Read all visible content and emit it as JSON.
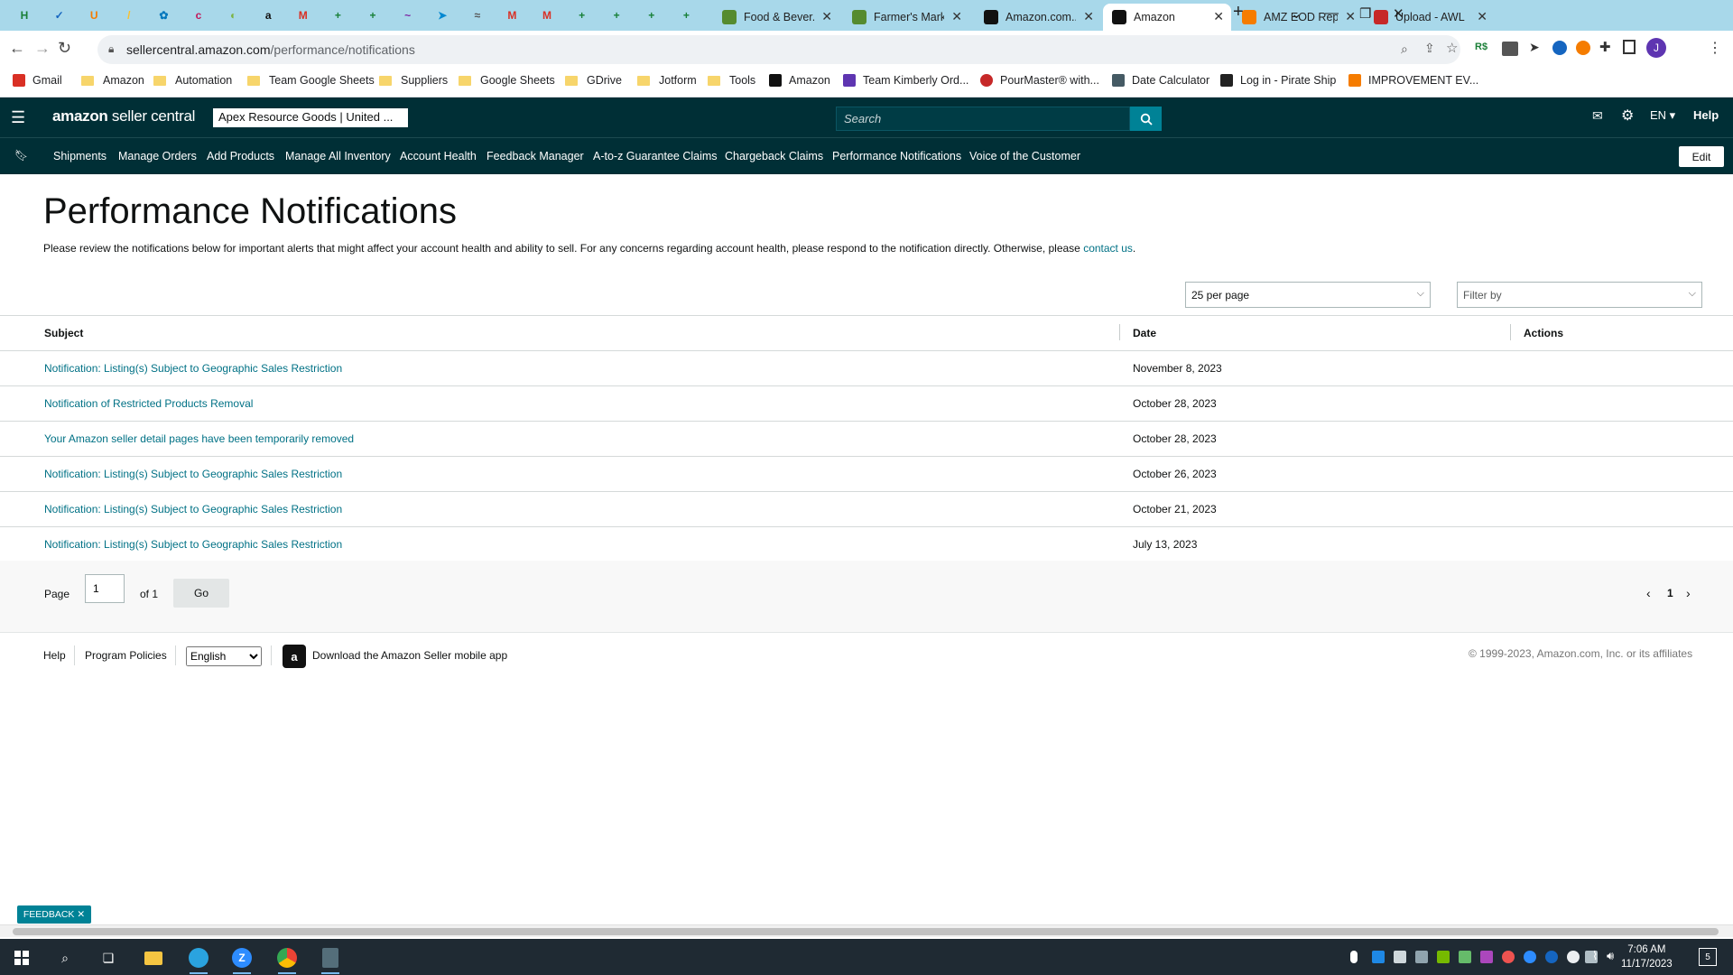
{
  "browser": {
    "pinned_tabs": [
      {
        "icon": "sheets-icon",
        "color": "#1a7f37",
        "glyph": "H"
      },
      {
        "icon": "check-icon",
        "color": "#1565c0",
        "glyph": "✓"
      },
      {
        "icon": "u-icon",
        "color": "#f57c00",
        "glyph": "U"
      },
      {
        "icon": "slash-icon",
        "color": "#fbc02d",
        "glyph": "/"
      },
      {
        "icon": "puzzle-icon",
        "color": "#0277bd",
        "glyph": "✿"
      },
      {
        "icon": "c-icon",
        "color": "#c2185b",
        "glyph": "c"
      },
      {
        "icon": "leaf-icon",
        "color": "#7cb342",
        "glyph": "◐"
      },
      {
        "icon": "amazon-icon",
        "color": "#111111",
        "glyph": "a"
      },
      {
        "icon": "gmail-icon",
        "color": "#d93025",
        "glyph": "M"
      },
      {
        "icon": "sheets-icon",
        "color": "#188038",
        "glyph": "+"
      },
      {
        "icon": "sheets-icon",
        "color": "#188038",
        "glyph": "+"
      },
      {
        "icon": "messenger-icon",
        "color": "#7b1fa2",
        "glyph": "~"
      },
      {
        "icon": "telegram-icon",
        "color": "#0288d1",
        "glyph": "➤"
      },
      {
        "icon": "signature-icon",
        "color": "#555555",
        "glyph": "≈"
      },
      {
        "icon": "gmail-icon",
        "color": "#d93025",
        "glyph": "M"
      },
      {
        "icon": "gmail-icon",
        "color": "#d93025",
        "glyph": "M"
      },
      {
        "icon": "sheets-icon",
        "color": "#188038",
        "glyph": "+"
      },
      {
        "icon": "sheets-icon",
        "color": "#188038",
        "glyph": "+"
      },
      {
        "icon": "sheets-icon",
        "color": "#188038",
        "glyph": "+"
      },
      {
        "icon": "sheets-icon",
        "color": "#188038",
        "glyph": "+"
      }
    ],
    "tabs": [
      {
        "title": "Food & Bever...",
        "icon": "plant-icon",
        "color": "#558b2f",
        "active": false
      },
      {
        "title": "Farmer's Mark...",
        "icon": "plant-icon",
        "color": "#558b2f",
        "active": false
      },
      {
        "title": "Amazon.com...",
        "icon": "amazon-icon",
        "color": "#111111",
        "active": false
      },
      {
        "title": "Amazon",
        "icon": "amazon-icon",
        "color": "#111111",
        "active": true
      },
      {
        "title": "AMZ EOD Rep...",
        "icon": "pen-icon",
        "color": "#f57c00",
        "active": false
      },
      {
        "title": "Upload - AWL",
        "icon": "heart-icon",
        "color": "#c62828",
        "active": false
      }
    ],
    "url_host": "sellercentral.amazon.com",
    "url_path": "/performance/notifications",
    "bookmarks": [
      {
        "label": "Gmail",
        "type": "gmail"
      },
      {
        "label": "Amazon",
        "type": "folder"
      },
      {
        "label": "Automation",
        "type": "folder"
      },
      {
        "label": "Team Google Sheets",
        "type": "folder"
      },
      {
        "label": "Suppliers",
        "type": "folder"
      },
      {
        "label": "Google Sheets",
        "type": "folder"
      },
      {
        "label": "GDrive",
        "type": "folder"
      },
      {
        "label": "Jotform",
        "type": "folder"
      },
      {
        "label": "Tools",
        "type": "folder"
      },
      {
        "label": "Amazon",
        "type": "amazon"
      },
      {
        "label": "Team Kimberly Ord...",
        "type": "form"
      },
      {
        "label": "PourMaster® with...",
        "type": "pour"
      },
      {
        "label": "Date Calculator",
        "type": "calc"
      },
      {
        "label": "Log in - Pirate Ship",
        "type": "pirate"
      },
      {
        "label": "IMPROVEMENT EV...",
        "type": "pen"
      }
    ]
  },
  "header": {
    "logo_bold": "amazon",
    "logo_rest": " seller central",
    "store": "Apex Resource Goods | United ...",
    "search_placeholder": "Search",
    "lang": "EN ▾",
    "help": "Help"
  },
  "quicknav": {
    "items": [
      "Shipments",
      "Manage Orders",
      "Add Products",
      "Manage All Inventory",
      "Account Health",
      "Feedback Manager",
      "A-to-z Guarantee Claims",
      "Chargeback Claims",
      "Performance Notifications",
      "Voice of the Customer"
    ],
    "edit": "Edit"
  },
  "page": {
    "title": "Performance Notifications",
    "intro": "Please review the notifications below for important alerts that might affect your account health and ability to sell. For any concerns regarding account health, please respond to the notification directly. Otherwise, please ",
    "contact": "contact us",
    "intro_end": ".",
    "per_page": "25 per page",
    "filter": "Filter by"
  },
  "table": {
    "headers": {
      "subject": "Subject",
      "date": "Date",
      "actions": "Actions"
    },
    "rows": [
      {
        "subject": "Notification: Listing(s) Subject to Geographic Sales Restriction",
        "date": "November 8, 2023"
      },
      {
        "subject": "Notification of Restricted Products Removal",
        "date": "October 28, 2023"
      },
      {
        "subject": "Your Amazon seller detail pages have been temporarily removed",
        "date": "October 28, 2023"
      },
      {
        "subject": "Notification: Listing(s) Subject to Geographic Sales Restriction",
        "date": "October 26, 2023"
      },
      {
        "subject": "Notification: Listing(s) Subject to Geographic Sales Restriction",
        "date": "October 21, 2023"
      },
      {
        "subject": "Notification: Listing(s) Subject to Geographic Sales Restriction",
        "date": "July 13, 2023"
      }
    ]
  },
  "pager": {
    "page_label": "Page",
    "page_value": "1",
    "of_label": "of 1",
    "go": "Go",
    "current": "1"
  },
  "footer": {
    "help": "Help",
    "policies": "Program Policies",
    "language": "English",
    "app": "Download the Amazon Seller mobile app",
    "copyright": "© 1999-2023, Amazon.com, Inc. or its affiliates"
  },
  "feedback": "FEEDBACK ✕",
  "taskbar": {
    "time": "7:06 AM",
    "date": "11/17/2023",
    "badge": "5"
  },
  "colors": {
    "header_bg": "#002f36",
    "link": "#007185",
    "accent": "#008296"
  }
}
